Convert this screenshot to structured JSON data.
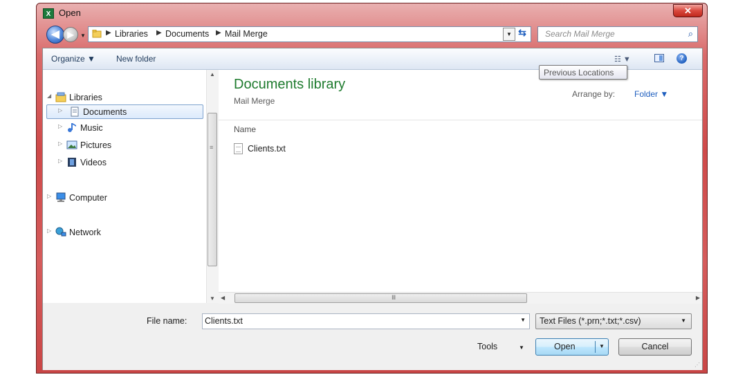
{
  "window": {
    "title": "Open",
    "app_icon_text": "X",
    "close_glyph": "✕"
  },
  "nav": {
    "back_glyph": "◀",
    "forward_glyph": "▶",
    "breadcrumbs": [
      "Libraries",
      "Documents",
      "Mail Merge"
    ],
    "search_placeholder": "Search Mail Merge",
    "refresh_icon": "refresh-icon",
    "tooltip": "Previous Locations"
  },
  "toolbar": {
    "organize_label": "Organize ▼",
    "new_folder_label": "New folder",
    "view_glyph": "☷ ▼",
    "help_glyph": "?"
  },
  "tree": [
    {
      "label": "Libraries",
      "icon": "libraries-icon",
      "expanded": true
    },
    {
      "label": "Documents",
      "icon": "documents-icon",
      "selected": true
    },
    {
      "label": "Music",
      "icon": "music-icon"
    },
    {
      "label": "Pictures",
      "icon": "pictures-icon"
    },
    {
      "label": "Videos",
      "icon": "videos-icon"
    },
    {
      "label": "Computer",
      "icon": "computer-icon"
    },
    {
      "label": "Network",
      "icon": "network-icon"
    }
  ],
  "content": {
    "library_title": "Documents library",
    "library_subtitle": "Mail Merge",
    "arrange_label": "Arrange by:",
    "arrange_value": "Folder ▼",
    "column_name": "Name",
    "files": [
      {
        "name": "Clients.txt",
        "icon": "text-file-icon"
      }
    ]
  },
  "bottom": {
    "file_name_label": "File name:",
    "file_name_value": "Clients.txt",
    "file_type_value": "Text Files (*.prn;*.txt;*.csv)",
    "tools_label": "Tools",
    "open_label": "Open",
    "cancel_label": "Cancel"
  },
  "colors": {
    "title_bar": "#d15252",
    "library_title": "#1e7b2e",
    "link_blue": "#1e5ebf"
  }
}
